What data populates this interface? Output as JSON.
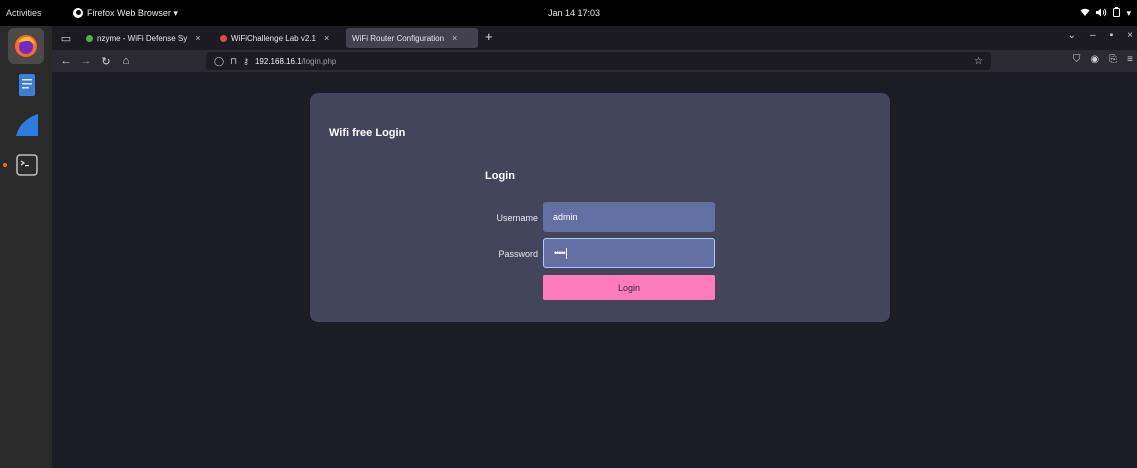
{
  "topbar": {
    "activities": "Activities",
    "app_menu": "Firefox Web Browser ▾",
    "clock": "Jan 14  17:03",
    "icons": [
      "wifi-icon",
      "volume-icon",
      "battery-icon",
      "chevron-down-icon"
    ]
  },
  "dock": {
    "items": [
      "firefox-icon",
      "text-editor-icon",
      "wireshark-icon",
      "terminal-icon"
    ]
  },
  "browser": {
    "tabs": [
      {
        "label": "nzyme - WiFi Defense Sy",
        "close": "×",
        "fav_color": "#4caf50"
      },
      {
        "label": "WiFiChallenge Lab v2.1",
        "close": "×",
        "fav_color": "#e04a4a"
      },
      {
        "label": "WiFi Router Configuration",
        "close": "×",
        "active": true
      }
    ],
    "new_tab": "+",
    "url_host": "192.168.16.1",
    "url_path": "/login.php"
  },
  "page": {
    "card_title": "Wifi free Login",
    "form_title": "Login",
    "username_label": "Username",
    "username_value": "admin",
    "password_label": "Password",
    "password_value": "•••••",
    "login_button": "Login"
  },
  "colors": {
    "card_bg": "#43455a",
    "field_bg": "#6370a4",
    "button_bg": "#ff7bc0",
    "page_bg": "#1b1c24"
  }
}
